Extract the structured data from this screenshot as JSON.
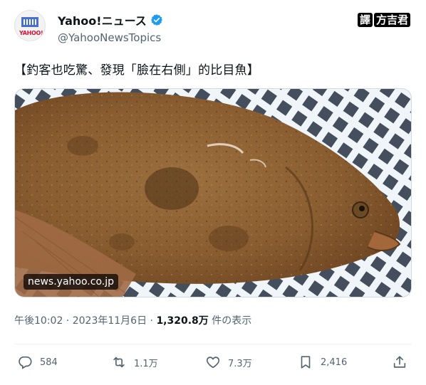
{
  "header": {
    "display_name": "Yahoo!ニュース",
    "handle": "@YahooNewsTopics",
    "avatar_logo": "YAHOO!",
    "verified_icon": "verified-badge-icon"
  },
  "watermark": {
    "left": "譯",
    "right": "方吉君"
  },
  "tweet": {
    "text": "【釣客也吃驚、發現「臉在右側」的比目魚】"
  },
  "media": {
    "link_label": "news.yahoo.co.jp"
  },
  "meta": {
    "time": "午後10:02",
    "sep1": " · ",
    "date": "2023年11月6日",
    "sep2": " · ",
    "views": "1,320.8万",
    "views_label": " 件の表示"
  },
  "actions": {
    "reply_count": "584",
    "retweet_count": "1.1万",
    "like_count": "7.3万",
    "bookmark_count": "2,416"
  }
}
